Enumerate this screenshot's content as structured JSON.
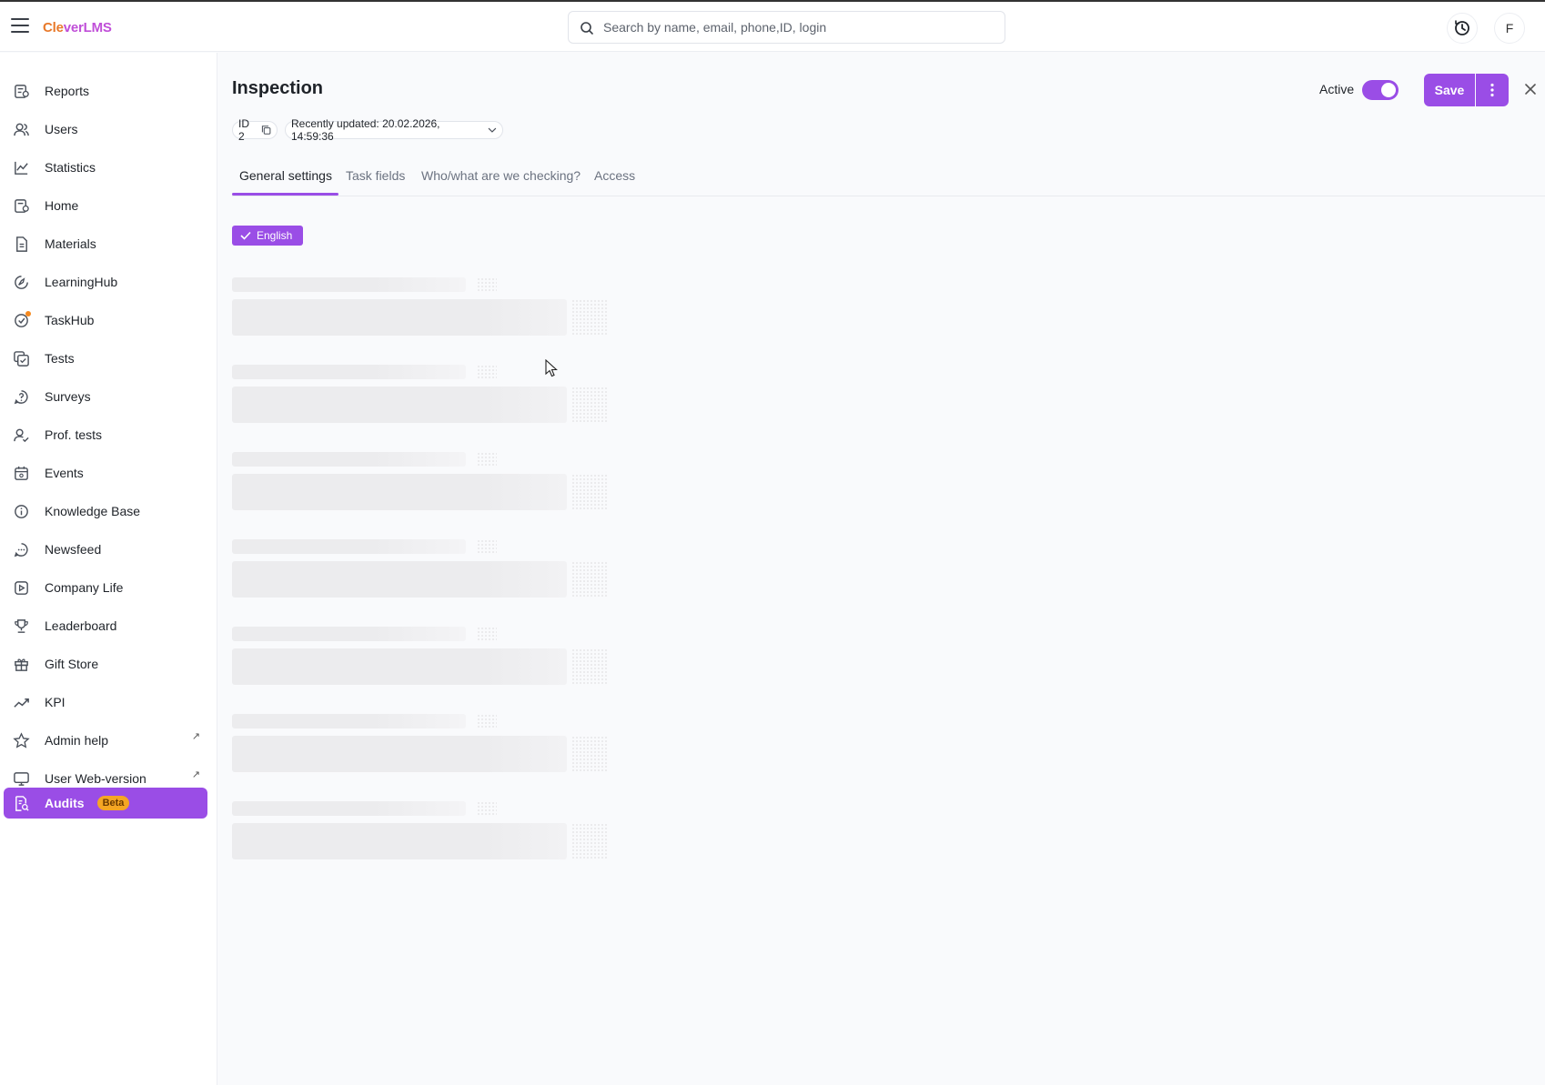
{
  "app": {
    "logo_part1": "Cle",
    "logo_part2": "verLMS"
  },
  "header": {
    "search_placeholder": "Search by name, email, phone,ID, login",
    "avatar_initial": "F"
  },
  "sidebar": {
    "items": [
      {
        "label": "Reports",
        "icon": "reports-icon"
      },
      {
        "label": "Users",
        "icon": "users-icon"
      },
      {
        "label": "Statistics",
        "icon": "statistics-icon"
      },
      {
        "label": "Home",
        "icon": "home-icon"
      },
      {
        "label": "Materials",
        "icon": "materials-icon"
      },
      {
        "label": "LearningHub",
        "icon": "learninghub-icon"
      },
      {
        "label": "TaskHub",
        "icon": "taskhub-icon"
      },
      {
        "label": "Tests",
        "icon": "tests-icon"
      },
      {
        "label": "Surveys",
        "icon": "surveys-icon"
      },
      {
        "label": "Prof. tests",
        "icon": "prof-tests-icon"
      },
      {
        "label": "Events",
        "icon": "events-icon"
      },
      {
        "label": "Knowledge Base",
        "icon": "info-icon"
      },
      {
        "label": "Newsfeed",
        "icon": "chat-icon"
      },
      {
        "label": "Company Life",
        "icon": "play-icon"
      },
      {
        "label": "Leaderboard",
        "icon": "trophy-icon"
      },
      {
        "label": "Gift Store",
        "icon": "gift-icon"
      },
      {
        "label": "KPI",
        "icon": "trend-icon"
      },
      {
        "label": "Admin help",
        "icon": "star-icon",
        "external": "↗"
      },
      {
        "label": "User Web-version",
        "icon": "monitor-icon",
        "external": "↗"
      },
      {
        "label": "Audits",
        "icon": "audits-icon",
        "badge": "Beta",
        "active": true
      }
    ]
  },
  "main": {
    "title": "Inspection",
    "active_label": "Active",
    "active_on": true,
    "save_label": "Save",
    "id_label": "ID 2",
    "updated_label": "Recently updated: 20.02.2026, 14:59:36",
    "tabs": [
      {
        "label": "General settings",
        "active": true
      },
      {
        "label": "Task fields"
      },
      {
        "label": "Who/what are we checking?"
      },
      {
        "label": "Access"
      }
    ],
    "language_chip": "English"
  },
  "colors": {
    "accent": "#9a4de6",
    "beta_badge": "#f5a623",
    "skeleton": "#ececee"
  }
}
